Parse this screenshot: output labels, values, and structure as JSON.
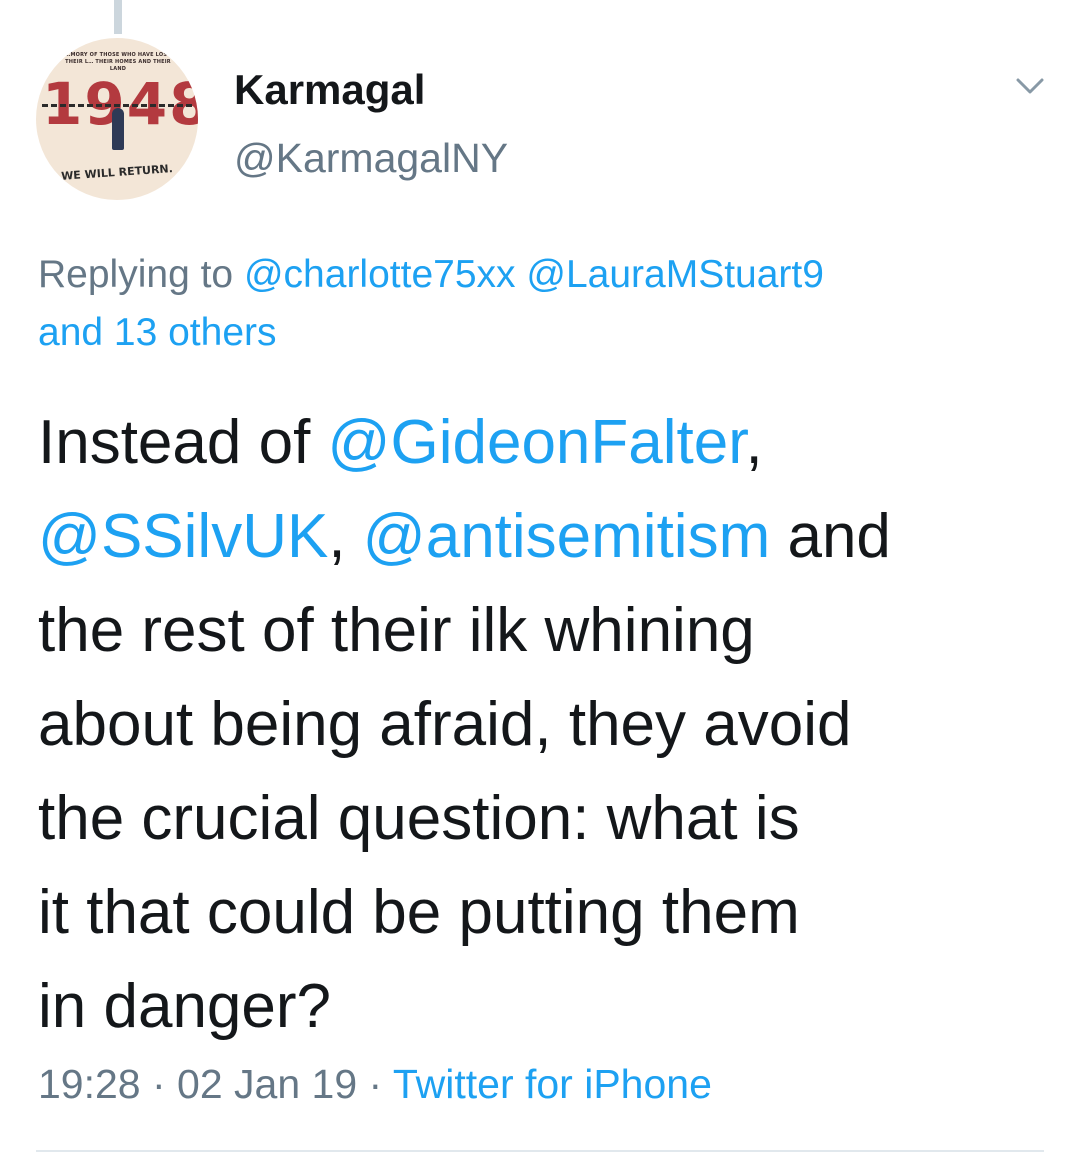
{
  "author": {
    "display_name": "Karmagal",
    "handle": "@KarmagalNY",
    "avatar": {
      "top_text": "…MORY OF THOSE WHO HAVE LOST THEIR L… THEIR HOMES AND THEIR LAND",
      "year": "1948",
      "tagline": "WE WILL RETURN."
    }
  },
  "reply": {
    "prefix": "Replying to",
    "users": [
      "@charlotte75xx",
      "@LauraMStuart9"
    ],
    "others": "and 13 others"
  },
  "tweet": {
    "line1_text": "Instead of ",
    "line1_mention": "@GideonFalter",
    "line1_end": ",",
    "line2_mention1": "@SSilvUK",
    "line2_sep": ", ",
    "line2_mention2": "@antisemitism",
    "line2_end": " and",
    "line3": "the rest of their ilk whining",
    "line4": "about being afraid, they avoid",
    "line5": "the crucial question: what is",
    "line6": "it that could be putting them",
    "line7": "in danger?"
  },
  "meta": {
    "time": "19:28",
    "sep1": " · ",
    "date": "02 Jan 19",
    "sep2": " · ",
    "source": "Twitter for iPhone"
  },
  "colors": {
    "link": "#1da1f2",
    "secondary_text": "#657786",
    "primary_text": "#14171a",
    "divider": "#e1e8ed"
  },
  "icons": {
    "menu": "chevron-down-icon"
  }
}
